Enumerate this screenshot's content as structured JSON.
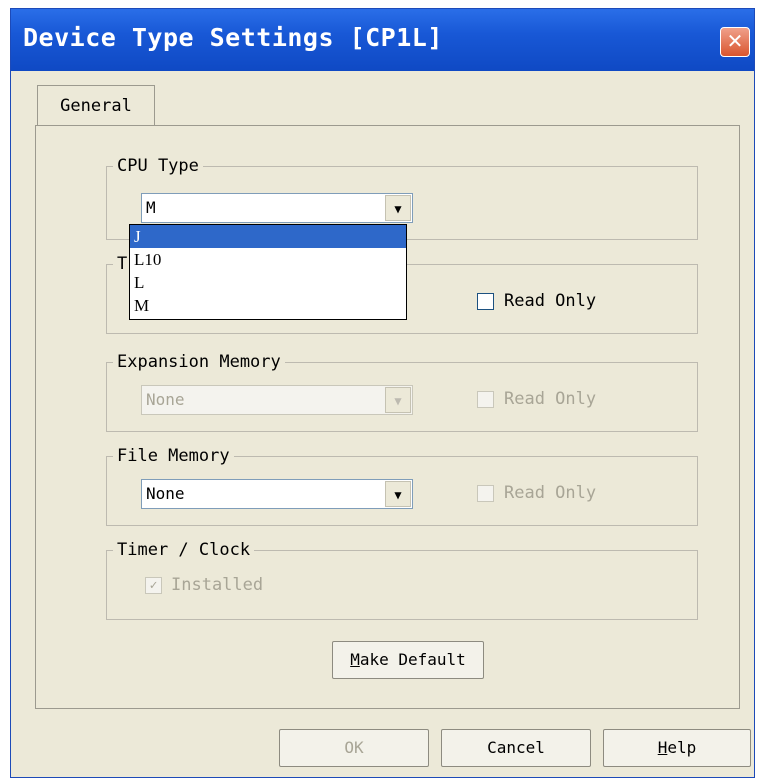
{
  "window": {
    "title": "Device Type Settings [CP1L]",
    "close_symbol": "✕"
  },
  "tabs": [
    {
      "label": "General"
    }
  ],
  "cpu_type": {
    "label": "CPU Type",
    "selected": "M",
    "options": [
      "J",
      "L10",
      "L",
      "M"
    ],
    "highlighted": "J"
  },
  "program_memory": {
    "label": "T",
    "read_only_label": "Read Only",
    "read_only_checked": false
  },
  "expansion_memory": {
    "label": "Expansion Memory",
    "value": "None",
    "read_only_label": "Read Only",
    "read_only_checked": false,
    "enabled": false
  },
  "file_memory": {
    "label": "File Memory",
    "value": "None",
    "read_only_label": "Read Only",
    "read_only_checked": false
  },
  "timer_clock": {
    "label": "Timer / Clock",
    "installed_label": "Installed",
    "installed_checked": true,
    "enabled": false
  },
  "buttons": {
    "make_default_prefix": "M",
    "make_default_rest": "ake Default",
    "ok": "OK",
    "cancel": "Cancel",
    "help_prefix": "H",
    "help_rest": "elp"
  },
  "icons": {
    "dropdown_arrow": "▼",
    "check_mark": "✓"
  }
}
